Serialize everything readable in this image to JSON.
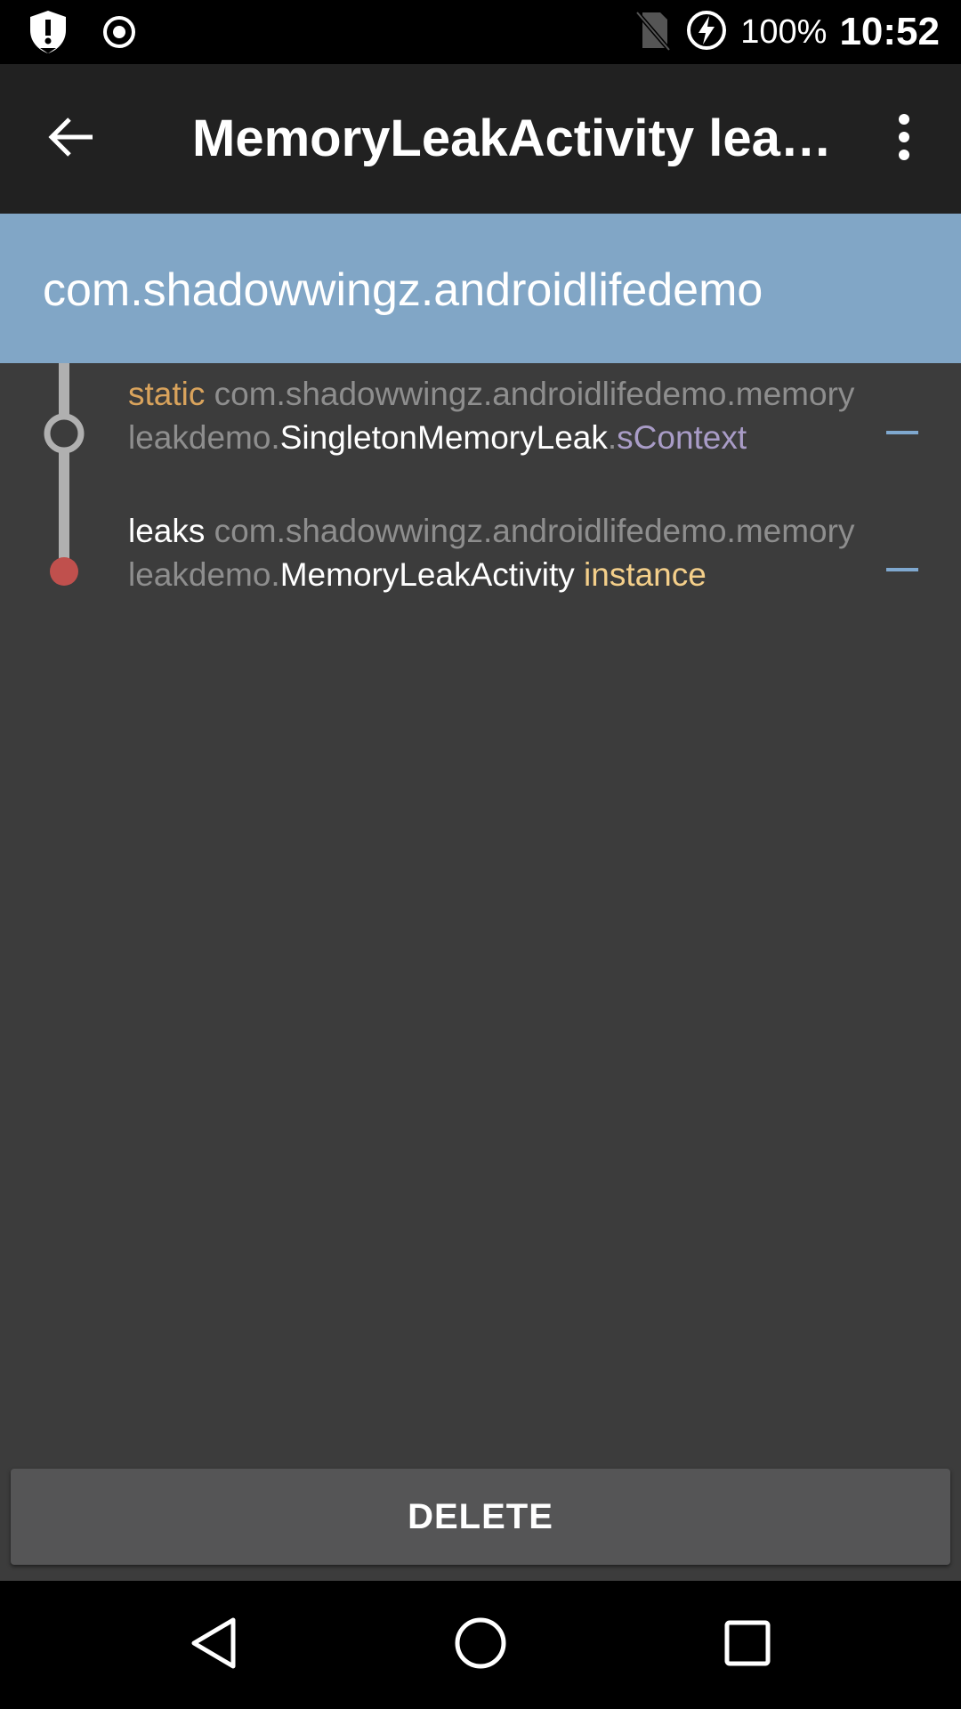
{
  "status_bar": {
    "battery_percent": "100%",
    "time": "10:52",
    "icons": [
      "shield-alert-icon",
      "record-icon",
      "no-sim-icon",
      "battery-charging-icon"
    ]
  },
  "app_bar": {
    "title": "MemoryLeakActivity leak…",
    "back_icon": "arrow-back-icon",
    "menu_icon": "more-vert-icon"
  },
  "package_header": {
    "name": "com.shadowwingz.androidlifedemo"
  },
  "leak_trace": [
    {
      "keyword": "static",
      "package": "com.shadowwingz.androidlifedemo.memoryleakdemo.",
      "class_name": "SingletonMemoryLeak",
      "separator": ".",
      "field": "sContext",
      "node": "reference"
    },
    {
      "keyword": "leaks",
      "package": "com.shadowwingz.androidlifedemo.memoryleakdemo.",
      "class_name": "MemoryLeakActivity",
      "suffix": "instance",
      "node": "leak"
    }
  ],
  "actions": {
    "delete_label": "DELETE"
  },
  "nav_bar": {
    "icons": [
      "back-triangle-icon",
      "home-circle-icon",
      "recents-square-icon"
    ]
  },
  "colors": {
    "app_bar": "#212121",
    "package_header": "#81a6c6",
    "background": "#3c3c3c",
    "keyword": "#d9a35c",
    "field": "#a99cc7",
    "instance": "#f4cf8a",
    "leak_node": "#c0504d"
  }
}
